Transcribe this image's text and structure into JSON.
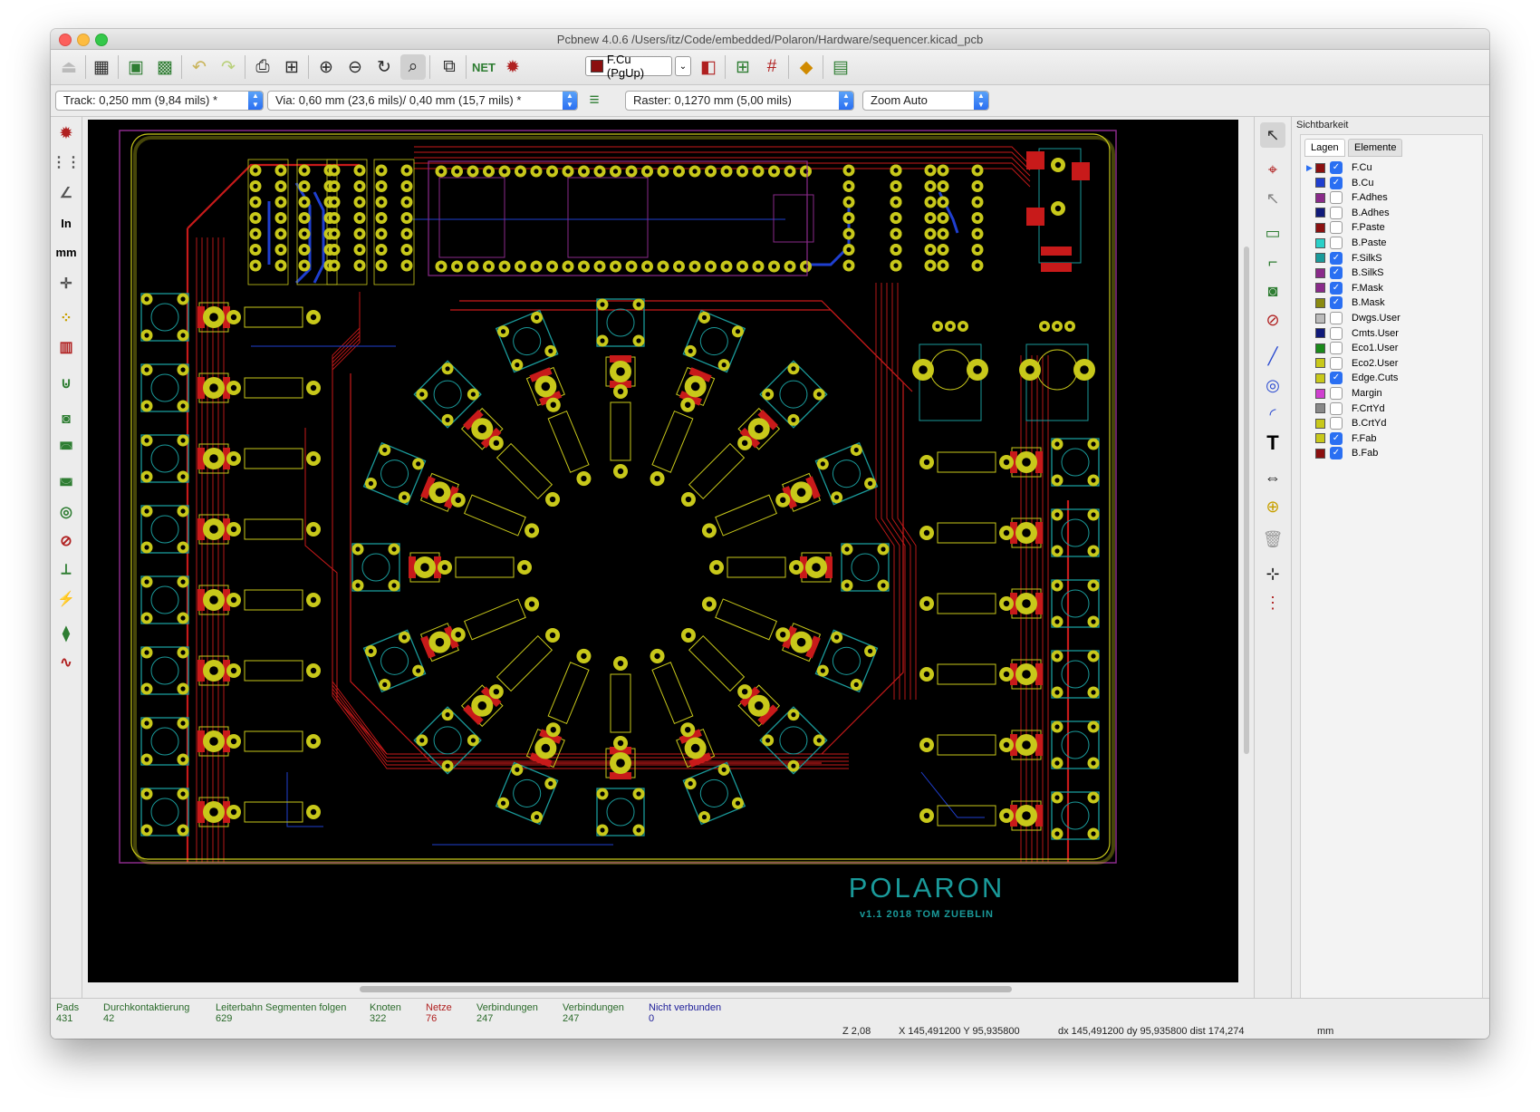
{
  "window": {
    "title": "Pcbnew 4.0.6 /Users/itz/Code/embedded/Polaron/Hardware/sequencer.kicad_pcb"
  },
  "toolbar": {
    "layer_select": "F.Cu (PgUp)"
  },
  "options": {
    "track": "Track: 0,250 mm (9,84 mils) *",
    "via": "Via: 0,60 mm (23,6 mils)/ 0,40 mm (15,7 mils) *",
    "raster": "Raster: 0,1270 mm (5,00 mils)",
    "zoom": "Zoom Auto"
  },
  "left_toolbar": {
    "units_in": "In",
    "units_mm": "mm"
  },
  "board": {
    "silk_title": "POLARON",
    "silk_subtitle": "v1.1 2018 TOM ZUEBLIN"
  },
  "visibility": {
    "title": "Sichtbarkeit",
    "tabs": [
      "Lagen",
      "Elemente"
    ],
    "layers": [
      {
        "name": "F.Cu",
        "color": "#8b1010",
        "checked": true
      },
      {
        "name": "B.Cu",
        "color": "#1f3fd0",
        "checked": true
      },
      {
        "name": "F.Adhes",
        "color": "#8a2a8a",
        "checked": false
      },
      {
        "name": "B.Adhes",
        "color": "#101a7a",
        "checked": false
      },
      {
        "name": "F.Paste",
        "color": "#8b1010",
        "checked": false
      },
      {
        "name": "B.Paste",
        "color": "#2ad0c8",
        "checked": false
      },
      {
        "name": "F.SilkS",
        "color": "#1a9a9a",
        "checked": true
      },
      {
        "name": "B.SilkS",
        "color": "#8a2a8a",
        "checked": true
      },
      {
        "name": "F.Mask",
        "color": "#8a2a8a",
        "checked": true
      },
      {
        "name": "B.Mask",
        "color": "#8a8a10",
        "checked": true
      },
      {
        "name": "Dwgs.User",
        "color": "#bbbbbb",
        "checked": false
      },
      {
        "name": "Cmts.User",
        "color": "#101a7a",
        "checked": false
      },
      {
        "name": "Eco1.User",
        "color": "#1a8a1a",
        "checked": false
      },
      {
        "name": "Eco2.User",
        "color": "#c8c81a",
        "checked": false
      },
      {
        "name": "Edge.Cuts",
        "color": "#c8c81a",
        "checked": true
      },
      {
        "name": "Margin",
        "color": "#d040d0",
        "checked": false
      },
      {
        "name": "F.CrtYd",
        "color": "#888888",
        "checked": false
      },
      {
        "name": "B.CrtYd",
        "color": "#c8c81a",
        "checked": false
      },
      {
        "name": "F.Fab",
        "color": "#c8c81a",
        "checked": true
      },
      {
        "name": "B.Fab",
        "color": "#8b1010",
        "checked": true
      }
    ]
  },
  "status": {
    "items": [
      {
        "label": "Pads",
        "value": "431",
        "color": "#2a6a2a"
      },
      {
        "label": "Durchkontaktierung",
        "value": "42",
        "color": "#2a6a2a"
      },
      {
        "label": "Leiterbahn Segmenten folgen",
        "value": "629",
        "color": "#2a6a2a"
      },
      {
        "label": "Knoten",
        "value": "322",
        "color": "#2a6a2a"
      },
      {
        "label": "Netze",
        "value": "76",
        "color": "#b02020"
      },
      {
        "label": "Verbindungen",
        "value": "247",
        "color": "#2a6a2a"
      },
      {
        "label": "Verbindungen",
        "value": "247",
        "color": "#2a6a2a"
      },
      {
        "label": "Nicht verbunden",
        "value": "0",
        "color": "#20209a"
      }
    ],
    "zoom": "Z 2,08",
    "coords": "X 145,491200  Y 95,935800",
    "delta": "dx 145,491200  dy 95,935800  dist 174,274",
    "units": "mm"
  },
  "colors": {
    "pcb_background": "#000000",
    "pad": "#c8c81a",
    "silk": "#1a9a9a",
    "front_copper": "#c81a1a",
    "back_copper": "#1f3fd0",
    "fab": "#c8c81a",
    "mask": "#8a2a8a"
  }
}
